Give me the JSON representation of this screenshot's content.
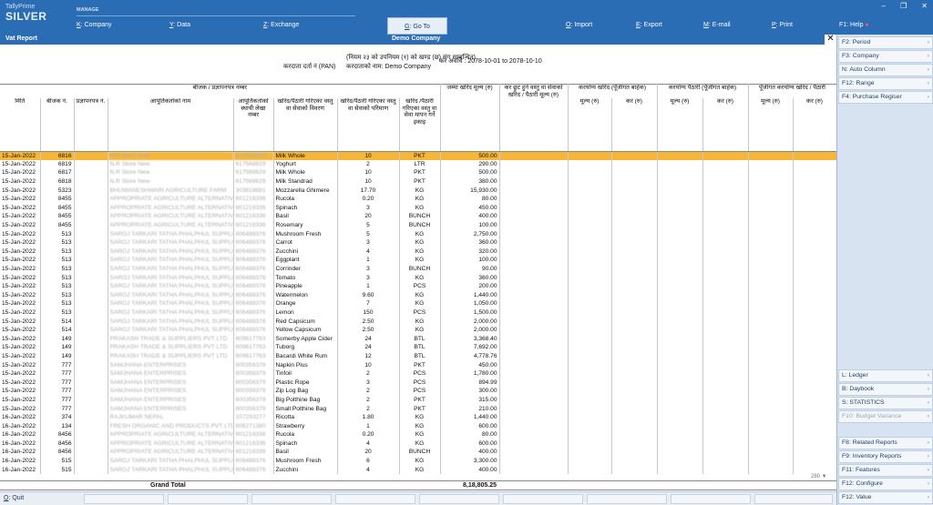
{
  "brand": {
    "line1": "TallyPrime",
    "line2": "SILVER"
  },
  "manage_label": "MANAGE",
  "menu": [
    {
      "key": "K",
      "label": ": Company"
    },
    {
      "key": "Y",
      "label": ": Data"
    },
    {
      "key": "Z",
      "label": ": Exchange"
    },
    {
      "key": "G",
      "label": ": Go To"
    },
    {
      "key": "O",
      "label": ": Import"
    },
    {
      "key": "E",
      "label": ": Export"
    },
    {
      "key": "M",
      "label": ": E-mail"
    },
    {
      "key": "P",
      "label": ": Print"
    },
    {
      "key": "F1",
      "label": ": Help"
    }
  ],
  "title": {
    "left": "Vat Report",
    "center": "Demo Company"
  },
  "report_header": {
    "rule_line": "(नियम २३ को उपनियम (१) को खण्ड (छ) संग सम्बन्धित)",
    "taxpayer_pan_label": "करदाता दर्ता नं (PAN)",
    "taxpayer_name": "करदाताको नाम: Demo Company",
    "tax_period": "कर अवधि : 2078-10-01 to 2078-10-10",
    "invoice_group": "बीजक / प्रज्ञापनपत्र नम्बर",
    "total_purchase_group": "जम्मा खरिद मूल्य (रु)",
    "exempt_group": "कर छुट हुने वस्तु वा सेवाको खरिद / पैठारी मूल्य (रु)",
    "taxable_purchase_group": "करयोग्य खरिद (पूँजीगत बाहेक)",
    "taxable_import_group": "करयोग्य पैठारी (पूँजीगत बाहेक)",
    "capital_group": "पूँजीगत करयोग्य खरिद / पैठारी"
  },
  "columns": {
    "date": "मिति",
    "invoice_no": "बीजक नं.",
    "pragyapan": "प्रज्ञापनपत्र नं.",
    "supplier_name": "आपूर्तिकर्ताको नाम",
    "supplier_pan": "आपूर्तिकर्ताको स्थायी लेखा नम्बर",
    "item_name": "खरिद/पैठारी गरिएका वस्तु वा सेवाको विवरण",
    "quantity": "खरिद/पैठारी गरिएका वस्तु वा सेवाको परिमाण",
    "unit": "खरिद /पैठारी गरिएका वस्तु वा सेवा मापन गर्ने इकाइ",
    "value": "मूल्य (रु)",
    "tax": "कर (रु)"
  },
  "rows": [
    {
      "date": "15-Jan-2022",
      "inv": "6816",
      "supplier": "N.R Store New",
      "pan": "617568629",
      "item": "Milk Whole",
      "qty": "10",
      "unit": "PKT",
      "amt": "500.00",
      "selected": true
    },
    {
      "date": "15-Jan-2022",
      "inv": "6819",
      "supplier": "N.R Store New",
      "pan": "617568629",
      "item": "Yoghurt",
      "qty": "2",
      "unit": "LTR",
      "amt": "290.00"
    },
    {
      "date": "15-Jan-2022",
      "inv": "6817",
      "supplier": "N.R Store New",
      "pan": "617568629",
      "item": "Milk Whole",
      "qty": "10",
      "unit": "PKT",
      "amt": "500.00"
    },
    {
      "date": "15-Jan-2022",
      "inv": "6818",
      "supplier": "N.R Store New",
      "pan": "617568629",
      "item": "Milk Standrad",
      "qty": "10",
      "unit": "PKT",
      "amt": "380.00"
    },
    {
      "date": "15-Jan-2022",
      "inv": "5323",
      "supplier": "BHUWANESHWARI AGRICULTURE FARM",
      "pan": "303818681",
      "item": "Mozzarella Ghimere",
      "qty": "17.70",
      "unit": "KG",
      "amt": "15,930.00"
    },
    {
      "date": "15-Jan-2022",
      "inv": "8455",
      "supplier": "APPROPRIATE AGRICULTURE ALTERNATIVES",
      "pan": "601216336",
      "item": "Rucola",
      "qty": "0.20",
      "unit": "KG",
      "amt": "80.00"
    },
    {
      "date": "15-Jan-2022",
      "inv": "8455",
      "supplier": "APPROPRIATE AGRICULTURE ALTERNATIVES",
      "pan": "601216336",
      "item": "Spinach",
      "qty": "3",
      "unit": "KG",
      "amt": "450.00"
    },
    {
      "date": "15-Jan-2022",
      "inv": "8455",
      "supplier": "APPROPRIATE AGRICULTURE ALTERNATIVES",
      "pan": "601216336",
      "item": "Basil",
      "qty": "20",
      "unit": "BUNCH",
      "amt": "400.00"
    },
    {
      "date": "15-Jan-2022",
      "inv": "8455",
      "supplier": "APPROPRIATE AGRICULTURE ALTERNATIVES",
      "pan": "601216336",
      "item": "Rosemary",
      "qty": "5",
      "unit": "BUNCH",
      "amt": "100.00"
    },
    {
      "date": "15-Jan-2022",
      "inv": "513",
      "supplier": "SAROJ TARKARI TATHA PHALPHUL SUPPLIERS",
      "pan": "606488376",
      "item": "Mushroom Fresh",
      "qty": "5",
      "unit": "KG",
      "amt": "2,750.00"
    },
    {
      "date": "15-Jan-2022",
      "inv": "513",
      "supplier": "SAROJ TARKARI TATHA PHALPHUL SUPPLIERS",
      "pan": "606488376",
      "item": "Carrot",
      "qty": "3",
      "unit": "KG",
      "amt": "360.00"
    },
    {
      "date": "15-Jan-2022",
      "inv": "513",
      "supplier": "SAROJ TARKARI TATHA PHALPHUL SUPPLIERS",
      "pan": "606488376",
      "item": "Zucchini",
      "qty": "4",
      "unit": "KG",
      "amt": "320.00"
    },
    {
      "date": "15-Jan-2022",
      "inv": "513",
      "supplier": "SAROJ TARKARI TATHA PHALPHUL SUPPLIERS",
      "pan": "606488376",
      "item": "Eggplant",
      "qty": "1",
      "unit": "KG",
      "amt": "100.00"
    },
    {
      "date": "15-Jan-2022",
      "inv": "513",
      "supplier": "SAROJ TARKARI TATHA PHALPHUL SUPPLIERS",
      "pan": "606488376",
      "item": "Corrinder",
      "qty": "3",
      "unit": "BUNCH",
      "amt": "90.00"
    },
    {
      "date": "15-Jan-2022",
      "inv": "513",
      "supplier": "SAROJ TARKARI TATHA PHALPHUL SUPPLIERS",
      "pan": "606488376",
      "item": "Tomato",
      "qty": "3",
      "unit": "KG",
      "amt": "360.00"
    },
    {
      "date": "15-Jan-2022",
      "inv": "513",
      "supplier": "SAROJ TARKARI TATHA PHALPHUL SUPPLIERS",
      "pan": "606488376",
      "item": "Pineapple",
      "qty": "1",
      "unit": "PCS",
      "amt": "200.00"
    },
    {
      "date": "15-Jan-2022",
      "inv": "513",
      "supplier": "SAROJ TARKARI TATHA PHALPHUL SUPPLIERS",
      "pan": "606488376",
      "item": "Watermelon",
      "qty": "9.60",
      "unit": "KG",
      "amt": "1,440.00"
    },
    {
      "date": "15-Jan-2022",
      "inv": "513",
      "supplier": "SAROJ TARKARI TATHA PHALPHUL SUPPLIERS",
      "pan": "606488376",
      "item": "Orange",
      "qty": "7",
      "unit": "KG",
      "amt": "1,050.00"
    },
    {
      "date": "15-Jan-2022",
      "inv": "513",
      "supplier": "SAROJ TARKARI TATHA PHALPHUL SUPPLIERS",
      "pan": "606488376",
      "item": "Lemon",
      "qty": "150",
      "unit": "PCS",
      "amt": "1,500.00"
    },
    {
      "date": "15-Jan-2022",
      "inv": "514",
      "supplier": "SAROJ TARKARI TATHA PHALPHUL SUPPLIERS",
      "pan": "606488376",
      "item": "Red Capsicum",
      "qty": "2.50",
      "unit": "KG",
      "amt": "2,000.00"
    },
    {
      "date": "15-Jan-2022",
      "inv": "514",
      "supplier": "SAROJ TARKARI TATHA PHALPHUL SUPPLIERS",
      "pan": "606488376",
      "item": "Yellow Capsicum",
      "qty": "2.50",
      "unit": "KG",
      "amt": "2,000.00"
    },
    {
      "date": "15-Jan-2022",
      "inv": "149",
      "supplier": "PRAKASH TRADE & SUPPLIERS PVT LTD",
      "pan": "609617763",
      "item": "Somerby Apple Cider",
      "qty": "24",
      "unit": "BTL",
      "amt": "3,368.40"
    },
    {
      "date": "15-Jan-2022",
      "inv": "149",
      "supplier": "PRAKASH TRADE & SUPPLIERS PVT LTD",
      "pan": "609617763",
      "item": "Tuborg",
      "qty": "24",
      "unit": "BTL",
      "amt": "7,692.00"
    },
    {
      "date": "15-Jan-2022",
      "inv": "149",
      "supplier": "PRAKASH TRADE & SUPPLIERS PVT LTD",
      "pan": "609617763",
      "item": "Bacardi White Rum",
      "qty": "12",
      "unit": "BTL",
      "amt": "4,778.76"
    },
    {
      "date": "15-Jan-2022",
      "inv": "777",
      "supplier": "SAMJHANA ENTERPRISES",
      "pan": "600356379",
      "item": "Napkin Plus",
      "qty": "10",
      "unit": "PKT",
      "amt": "450.00"
    },
    {
      "date": "15-Jan-2022",
      "inv": "777",
      "supplier": "SAMJHANA ENTERPRISES",
      "pan": "600356379",
      "item": "Tinfoil",
      "qty": "2",
      "unit": "PCS",
      "amt": "1,780.00"
    },
    {
      "date": "15-Jan-2022",
      "inv": "777",
      "supplier": "SAMJHANA ENTERPRISES",
      "pan": "600356379",
      "item": "Plastic Rope",
      "qty": "3",
      "unit": "PCS",
      "amt": "894.99"
    },
    {
      "date": "15-Jan-2022",
      "inv": "777",
      "supplier": "SAMJHANA ENTERPRISES",
      "pan": "600356379",
      "item": "Zip Log Bag",
      "qty": "2",
      "unit": "PCS",
      "amt": "300.00"
    },
    {
      "date": "15-Jan-2022",
      "inv": "777",
      "supplier": "SAMJHANA ENTERPRISES",
      "pan": "600356379",
      "item": "Big Polthine Bag",
      "qty": "2",
      "unit": "PKT",
      "amt": "315.00"
    },
    {
      "date": "15-Jan-2022",
      "inv": "777",
      "supplier": "SAMJHANA ENTERPRISES",
      "pan": "600356379",
      "item": "Small Polthine Bag",
      "qty": "2",
      "unit": "PKT",
      "amt": "210.00"
    },
    {
      "date": "16-Jan-2022",
      "inv": "374",
      "supplier": "RAJKUMAR NEPAL",
      "pan": "107293277",
      "item": "Ricotta",
      "qty": "1.80",
      "unit": "KG",
      "amt": "1,440.00"
    },
    {
      "date": "16-Jan-2022",
      "inv": "134",
      "supplier": "FRESH ORGANIC AND PRODUCTS PVT LTD",
      "pan": "606271380",
      "item": "Strawberry",
      "qty": "1",
      "unit": "KG",
      "amt": "600.00"
    },
    {
      "date": "16-Jan-2022",
      "inv": "8456",
      "supplier": "APPROPRIATE AGRICULTURE ALTERNATIVES",
      "pan": "601216336",
      "item": "Rucola",
      "qty": "0.20",
      "unit": "KG",
      "amt": "80.00"
    },
    {
      "date": "16-Jan-2022",
      "inv": "8456",
      "supplier": "APPROPRIATE AGRICULTURE ALTERNATIVES",
      "pan": "601216336",
      "item": "Spinach",
      "qty": "4",
      "unit": "KG",
      "amt": "600.00"
    },
    {
      "date": "16-Jan-2022",
      "inv": "8456",
      "supplier": "APPROPRIATE AGRICULTURE ALTERNATIVES",
      "pan": "601216336",
      "item": "Basil",
      "qty": "20",
      "unit": "BUNCH",
      "amt": "400.00"
    },
    {
      "date": "16-Jan-2022",
      "inv": "515",
      "supplier": "SAROJ TARKARI TATHA PHALPHUL SUPPLIERS",
      "pan": "606488376",
      "item": "Mushroom Fresh",
      "qty": "6",
      "unit": "KG",
      "amt": "3,300.00"
    },
    {
      "date": "16-Jan-2022",
      "inv": "515",
      "supplier": "SAROJ TARKARI TATHA PHALPHUL SUPPLIERS",
      "pan": "606488376",
      "item": "Zucchini",
      "qty": "4",
      "unit": "KG",
      "amt": "400.00"
    }
  ],
  "page_count": "280 ▼",
  "total": {
    "label": "Grand Total",
    "value": "8,18,805.25"
  },
  "quit": {
    "key": "Q",
    "label": ": Quit"
  },
  "right_panel": {
    "top": [
      {
        "key": "F2",
        "label": ": Period",
        "arrow": "‹"
      },
      {
        "key": "F3",
        "label": ": Company",
        "arrow": "‹"
      },
      {
        "key": "N",
        "label": ": Auto Column",
        "arrow": "›"
      },
      {
        "key": "F12",
        "label": ": Range",
        "arrow": "›"
      },
      {
        "key": "F4",
        "label": ": Purchase Regiser",
        "arrow": "›"
      }
    ],
    "middle": [
      {
        "key": "L",
        "label": ": Ledger",
        "arrow": "›"
      },
      {
        "key": "B",
        "label": ": Daybook",
        "arrow": "›"
      },
      {
        "key": "S",
        "label": ": STATISTICS",
        "arrow": "›"
      },
      {
        "key": "F10",
        "label": ": Budget Variance",
        "arrow": "›",
        "disabled": true
      }
    ],
    "bottom": [
      {
        "key": "F8",
        "label": ": Related Reports",
        "arrow": "›"
      },
      {
        "key": "F9",
        "label": ": Inventory Reports",
        "arrow": "›"
      },
      {
        "key": "F11",
        "label": ": Features",
        "arrow": "›"
      },
      {
        "key": "F12",
        "label": ": Configure",
        "arrow": "›"
      },
      {
        "key": "F12",
        "label": ": Value",
        "arrow": "›"
      }
    ]
  }
}
